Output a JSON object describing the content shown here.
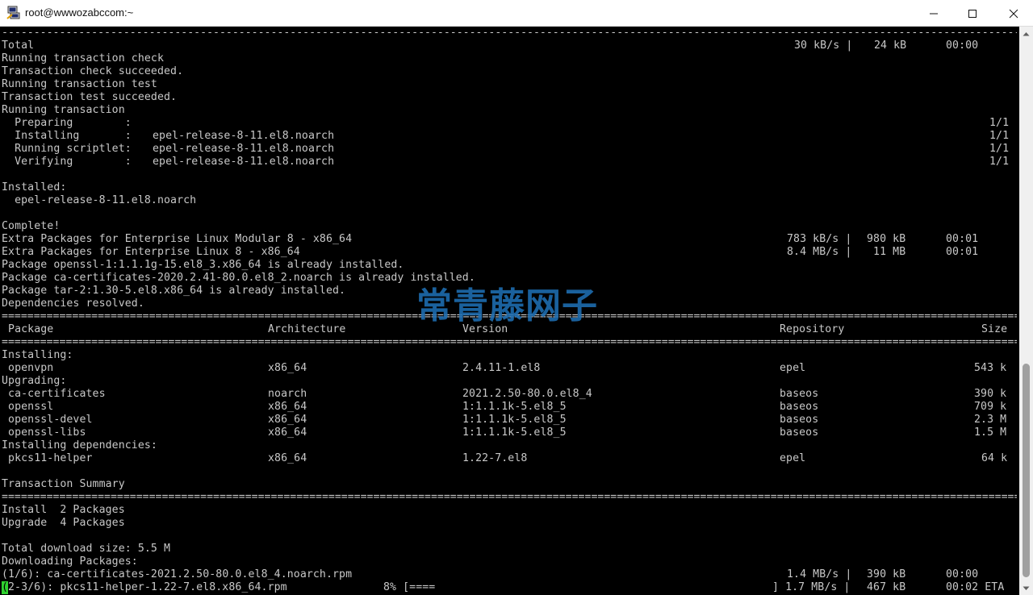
{
  "window": {
    "title": "root@wwwozabccom:~",
    "accent_bar_color": "#ffffff"
  },
  "terminal": {
    "rule_dash": "------------------------------------------------------------------------------------------------------------------------------------------------------------------------------------------------",
    "rule_eq": "================================================================================================================================================================================================",
    "header_total": {
      "label": "Total",
      "speed": "30 kB/s |",
      "size": "24 kB",
      "time": "00:00"
    },
    "pre_lines": [
      "Running transaction check",
      "Transaction check succeeded.",
      "Running transaction test",
      "Transaction test succeeded.",
      "Running transaction"
    ],
    "steps": [
      {
        "name": "  Preparing        :",
        "pkg": "",
        "count": "1/1"
      },
      {
        "name": "  Installing       :",
        "pkg": "epel-release-8-11.el8.noarch",
        "count": "1/1"
      },
      {
        "name": "  Running scriptlet:",
        "pkg": "epel-release-8-11.el8.noarch",
        "count": "1/1"
      },
      {
        "name": "  Verifying        :",
        "pkg": "epel-release-8-11.el8.noarch",
        "count": "1/1"
      }
    ],
    "installed_label": "Installed:",
    "installed_pkg": "  epel-release-8-11.el8.noarch",
    "complete": "Complete!",
    "repo_lines": [
      {
        "text": "Extra Packages for Enterprise Linux Modular 8 - x86_64",
        "speed": "783 kB/s |",
        "size": "980 kB",
        "time": "00:01"
      },
      {
        "text": "Extra Packages for Enterprise Linux 8 - x86_64",
        "speed": "8.4 MB/s |",
        "size": " 11 MB",
        "time": "00:01"
      }
    ],
    "already_lines": [
      "Package openssl-1:1.1.1g-15.el8_3.x86_64 is already installed.",
      "Package ca-certificates-2020.2.41-80.0.el8_2.noarch is already installed.",
      "Package tar-2:1.30-5.el8.x86_64 is already installed.",
      "Dependencies resolved."
    ],
    "table_header": {
      "package": " Package",
      "arch": "Architecture",
      "version": "Version",
      "repo": "Repository",
      "size": "Size"
    },
    "sections": [
      {
        "label": "Installing:",
        "rows": [
          {
            "package": " openvpn",
            "arch": "x86_64",
            "version": "2.4.11-1.el8",
            "repo": "epel",
            "size": "543 k"
          }
        ]
      },
      {
        "label": "Upgrading:",
        "rows": [
          {
            "package": " ca-certificates",
            "arch": "noarch",
            "version": "2021.2.50-80.0.el8_4",
            "repo": "baseos",
            "size": "390 k"
          },
          {
            "package": " openssl",
            "arch": "x86_64",
            "version": "1:1.1.1k-5.el8_5",
            "repo": "baseos",
            "size": "709 k"
          },
          {
            "package": " openssl-devel",
            "arch": "x86_64",
            "version": "1:1.1.1k-5.el8_5",
            "repo": "baseos",
            "size": "2.3 M"
          },
          {
            "package": " openssl-libs",
            "arch": "x86_64",
            "version": "1:1.1.1k-5.el8_5",
            "repo": "baseos",
            "size": "1.5 M"
          }
        ]
      },
      {
        "label": "Installing dependencies:",
        "rows": [
          {
            "package": " pkcs11-helper",
            "arch": "x86_64",
            "version": "1.22-7.el8",
            "repo": "epel",
            "size": "64 k"
          }
        ]
      }
    ],
    "summary_label": "Transaction Summary",
    "summary_lines": [
      "Install  2 Packages",
      "Upgrade  4 Packages"
    ],
    "download_size": "Total download size: 5.5 M",
    "downloading": "Downloading Packages:",
    "dl_1": {
      "text": "(1/6): ca-certificates-2021.2.50-80.0.el8_4.noarch.rpm",
      "speed": "1.4 MB/s |",
      "size": "390 kB",
      "time": "00:00"
    },
    "dl_2": {
      "cursor_char": "(",
      "text": "2-3/6): pkcs11-helper-1.22-7.el8.x86_64.rpm",
      "percent": "8% [====",
      "bar_end": "] 1.7 MB/s |",
      "size": "467 kB",
      "time": "00:02 ETA"
    }
  },
  "watermark": "常青藤网子"
}
